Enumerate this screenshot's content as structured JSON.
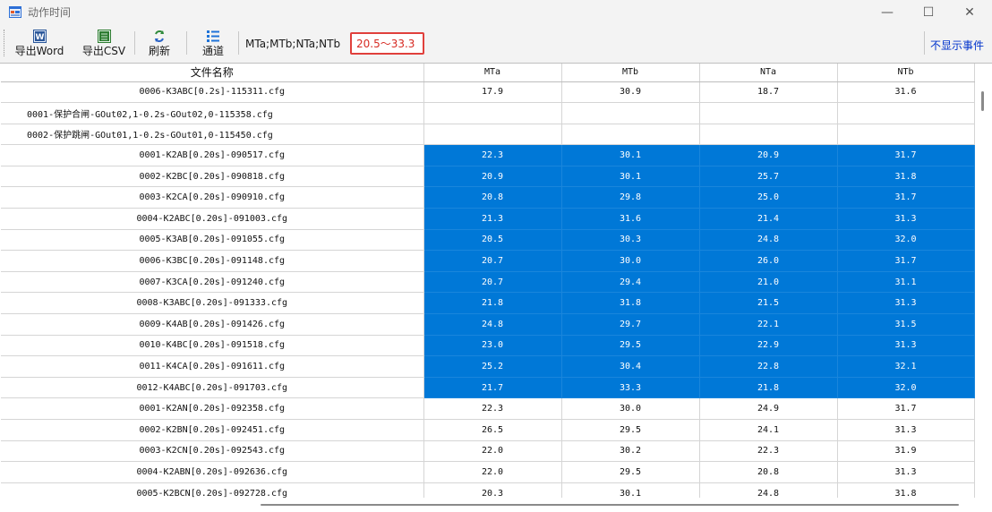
{
  "window": {
    "title": "动作时间",
    "minimize_glyph": "—",
    "maximize_glyph": "☐",
    "close_glyph": "✕"
  },
  "toolbar": {
    "buttons": [
      {
        "label": "导出Word",
        "icon": "word-icon"
      },
      {
        "label": "导出CSV",
        "icon": "csv-icon"
      },
      {
        "label": "刷新",
        "icon": "refresh-icon"
      },
      {
        "label": "通道",
        "icon": "channel-list-icon"
      }
    ],
    "channels_text": "MTa;MTb;NTa;NTb",
    "range_text": "20.5～33.3",
    "hide_events_label": "不显示事件"
  },
  "grid": {
    "columns": [
      "文件名称",
      "MTa",
      "MTb",
      "NTa",
      "NTb"
    ],
    "selection_color": "#0078d7",
    "rows": [
      {
        "name": "0006-K3ABC[0.2s]-115311.cfg",
        "values": [
          "17.9",
          "30.9",
          "18.7",
          "31.6"
        ],
        "selected": false,
        "align": "center"
      },
      {
        "name": "0001-保护合闸-GOut02,1-0.2s-GOut02,0-115358.cfg",
        "values": [
          "",
          "",
          "",
          ""
        ],
        "selected": false,
        "align": "left"
      },
      {
        "name": "0002-保护跳闸-GOut01,1-0.2s-GOut01,0-115450.cfg",
        "values": [
          "",
          "",
          "",
          ""
        ],
        "selected": false,
        "align": "left"
      },
      {
        "name": "0001-K2AB[0.20s]-090517.cfg",
        "values": [
          "22.3",
          "30.1",
          "20.9",
          "31.7"
        ],
        "selected": true,
        "align": "center"
      },
      {
        "name": "0002-K2BC[0.20s]-090818.cfg",
        "values": [
          "20.9",
          "30.1",
          "25.7",
          "31.8"
        ],
        "selected": true,
        "align": "center"
      },
      {
        "name": "0003-K2CA[0.20s]-090910.cfg",
        "values": [
          "20.8",
          "29.8",
          "25.0",
          "31.7"
        ],
        "selected": true,
        "align": "center"
      },
      {
        "name": "0004-K2ABC[0.20s]-091003.cfg",
        "values": [
          "21.3",
          "31.6",
          "21.4",
          "31.3"
        ],
        "selected": true,
        "align": "center"
      },
      {
        "name": "0005-K3AB[0.20s]-091055.cfg",
        "values": [
          "20.5",
          "30.3",
          "24.8",
          "32.0"
        ],
        "selected": true,
        "align": "center"
      },
      {
        "name": "0006-K3BC[0.20s]-091148.cfg",
        "values": [
          "20.7",
          "30.0",
          "26.0",
          "31.7"
        ],
        "selected": true,
        "align": "center"
      },
      {
        "name": "0007-K3CA[0.20s]-091240.cfg",
        "values": [
          "20.7",
          "29.4",
          "21.0",
          "31.1"
        ],
        "selected": true,
        "align": "center"
      },
      {
        "name": "0008-K3ABC[0.20s]-091333.cfg",
        "values": [
          "21.8",
          "31.8",
          "21.5",
          "31.3"
        ],
        "selected": true,
        "align": "center"
      },
      {
        "name": "0009-K4AB[0.20s]-091426.cfg",
        "values": [
          "24.8",
          "29.7",
          "22.1",
          "31.5"
        ],
        "selected": true,
        "align": "center"
      },
      {
        "name": "0010-K4BC[0.20s]-091518.cfg",
        "values": [
          "23.0",
          "29.5",
          "22.9",
          "31.3"
        ],
        "selected": true,
        "align": "center"
      },
      {
        "name": "0011-K4CA[0.20s]-091611.cfg",
        "values": [
          "25.2",
          "30.4",
          "22.8",
          "32.1"
        ],
        "selected": true,
        "align": "center"
      },
      {
        "name": "0012-K4ABC[0.20s]-091703.cfg",
        "values": [
          "21.7",
          "33.3",
          "21.8",
          "32.0"
        ],
        "selected": true,
        "align": "center"
      },
      {
        "name": "0001-K2AN[0.20s]-092358.cfg",
        "values": [
          "22.3",
          "30.0",
          "24.9",
          "31.7"
        ],
        "selected": false,
        "align": "center"
      },
      {
        "name": "0002-K2BN[0.20s]-092451.cfg",
        "values": [
          "26.5",
          "29.5",
          "24.1",
          "31.3"
        ],
        "selected": false,
        "align": "center"
      },
      {
        "name": "0003-K2CN[0.20s]-092543.cfg",
        "values": [
          "22.0",
          "30.2",
          "22.3",
          "31.9"
        ],
        "selected": false,
        "align": "center"
      },
      {
        "name": "0004-K2ABN[0.20s]-092636.cfg",
        "values": [
          "22.0",
          "29.5",
          "20.8",
          "31.3"
        ],
        "selected": false,
        "align": "center"
      },
      {
        "name": "0005-K2BCN[0.20s]-092728.cfg",
        "values": [
          "20.3",
          "30.1",
          "24.8",
          "31.8"
        ],
        "selected": false,
        "align": "center"
      }
    ]
  }
}
